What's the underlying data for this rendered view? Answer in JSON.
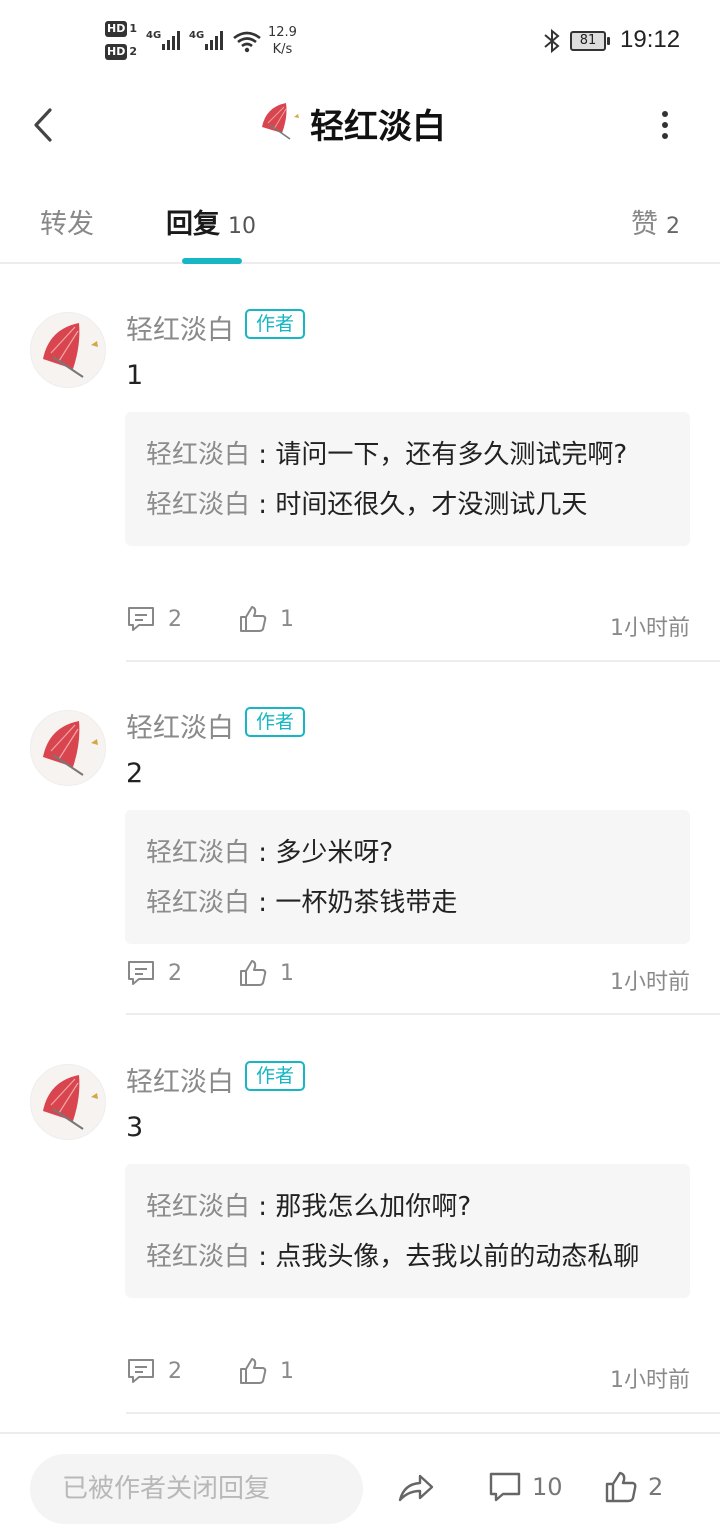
{
  "status_bar": {
    "sim1": "HD",
    "sim1_index": "1",
    "sim2": "HD",
    "sim2_index": "2",
    "network1": "4G",
    "network2": "4G",
    "speed_value": "12.9",
    "speed_unit": "K/s",
    "battery": "81",
    "time": "19:12",
    "icons": [
      "hd-icon",
      "signal-icon",
      "wifi-icon",
      "bluetooth-icon",
      "battery-icon"
    ]
  },
  "header": {
    "title": "轻红淡白",
    "icons": [
      "back-arrow-icon",
      "umbrella-avatar",
      "more-vertical-icon"
    ]
  },
  "tabs": {
    "forward": "转发",
    "reply": "回复",
    "reply_count": "10",
    "like": "赞",
    "like_count": "2"
  },
  "accent_color": "#16b6c4",
  "comments": [
    {
      "name": "轻红淡白",
      "badge": "作者",
      "text": "1",
      "replies": [
        {
          "name": "轻红淡白",
          "sep": " : ",
          "text": "请问一下，还有多久测试完啊?"
        },
        {
          "name": "轻红淡白",
          "sep": " : ",
          "text": "时间还很久，才没测试几天"
        }
      ],
      "reply_count": "2",
      "like_count": "1",
      "time": "1小时前"
    },
    {
      "name": "轻红淡白",
      "badge": "作者",
      "text": "2",
      "replies": [
        {
          "name": "轻红淡白",
          "sep": " : ",
          "text": "多少米呀?"
        },
        {
          "name": "轻红淡白",
          "sep": " : ",
          "text": "一杯奶茶钱带走"
        }
      ],
      "reply_count": "2",
      "like_count": "1",
      "time": "1小时前"
    },
    {
      "name": "轻红淡白",
      "badge": "作者",
      "text": "3",
      "replies": [
        {
          "name": "轻红淡白",
          "sep": " : ",
          "text": "那我怎么加你啊?"
        },
        {
          "name": "轻红淡白",
          "sep": " : ",
          "text": "点我头像，去我以前的动态私聊"
        }
      ],
      "reply_count": "2",
      "like_count": "1",
      "time": "1小时前"
    }
  ],
  "bottom_bar": {
    "input_placeholder": "已被作者关闭回复",
    "comment_count": "10",
    "like_count": "2"
  }
}
